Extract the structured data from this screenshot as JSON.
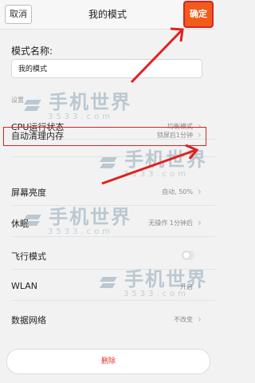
{
  "header": {
    "cancel_label": "取消",
    "title": "我的模式",
    "confirm_label": "确定"
  },
  "form": {
    "name_label": "模式名称:",
    "name_value": "我的模式"
  },
  "section_label": "设置",
  "settings": [
    {
      "label": "CPU运行状态",
      "value": "均衡模式"
    },
    {
      "label": "自动清理内存",
      "value": "锁屏后1分钟"
    },
    {
      "label": "屏幕亮度",
      "value": "自动, 50%"
    },
    {
      "label": "休眠",
      "value": "无操作 1分钟后"
    },
    {
      "label": "飞行模式",
      "value": ""
    },
    {
      "label": "WLAN",
      "value": "开启"
    },
    {
      "label": "数据网络",
      "value": "不改变"
    }
  ],
  "delete_label": "删除",
  "watermark": {
    "text": "手机世界",
    "subtext": "3533.com"
  },
  "colors": {
    "accent": "#f05c1c",
    "highlight": "#e02020",
    "delete_text": "#e0342c"
  }
}
